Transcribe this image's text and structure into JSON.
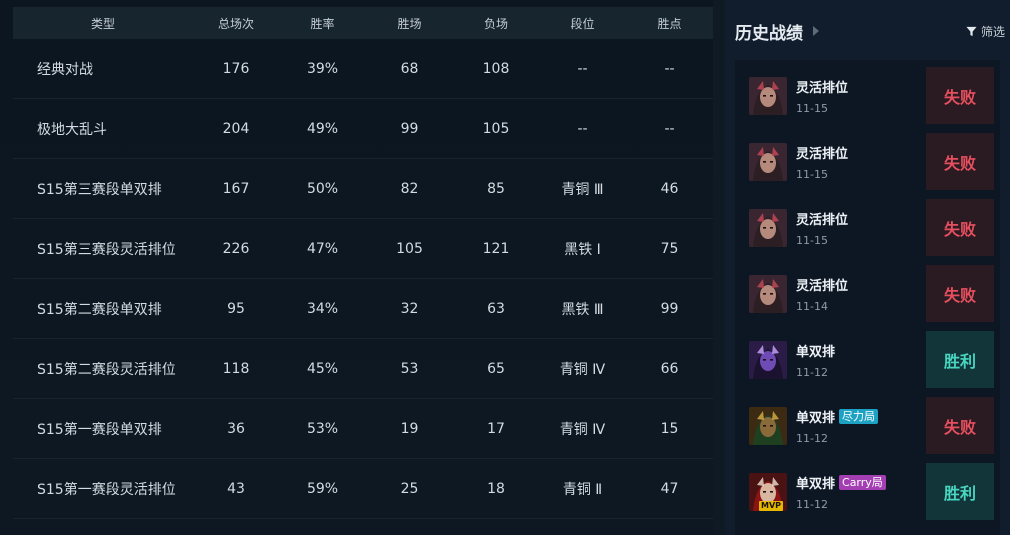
{
  "stats": {
    "headers": [
      "类型",
      "总场次",
      "胜率",
      "胜场",
      "负场",
      "段位",
      "胜点"
    ],
    "rows": [
      [
        "经典对战",
        "176",
        "39%",
        "68",
        "108",
        "--",
        "--"
      ],
      [
        "极地大乱斗",
        "204",
        "49%",
        "99",
        "105",
        "--",
        "--"
      ],
      [
        "S15第三赛段单双排",
        "167",
        "50%",
        "82",
        "85",
        "青铜 Ⅲ",
        "46"
      ],
      [
        "S15第三赛段灵活排位",
        "226",
        "47%",
        "105",
        "121",
        "黑铁 Ⅰ",
        "75"
      ],
      [
        "S15第二赛段单双排",
        "95",
        "34%",
        "32",
        "63",
        "黑铁 Ⅲ",
        "99"
      ],
      [
        "S15第二赛段灵活排位",
        "118",
        "45%",
        "53",
        "65",
        "青铜 Ⅳ",
        "66"
      ],
      [
        "S15第一赛段单双排",
        "36",
        "53%",
        "19",
        "17",
        "青铜 Ⅳ",
        "15"
      ],
      [
        "S15第一赛段灵活排位",
        "43",
        "59%",
        "25",
        "18",
        "青铜 Ⅱ",
        "47"
      ]
    ]
  },
  "history": {
    "title": "历史战绩",
    "filter_label": "筛选",
    "matches": [
      {
        "mode": "灵活排位",
        "date": "11-15",
        "result": "失败",
        "outcome": "loss",
        "champion_icon": "champion-avatar-icon",
        "tag": "",
        "mvp": ""
      },
      {
        "mode": "灵活排位",
        "date": "11-15",
        "result": "失败",
        "outcome": "loss",
        "champion_icon": "champion-avatar-icon",
        "tag": "",
        "mvp": ""
      },
      {
        "mode": "灵活排位",
        "date": "11-15",
        "result": "失败",
        "outcome": "loss",
        "champion_icon": "champion-avatar-icon",
        "tag": "",
        "mvp": ""
      },
      {
        "mode": "灵活排位",
        "date": "11-14",
        "result": "失败",
        "outcome": "loss",
        "champion_icon": "champion-avatar-icon",
        "tag": "",
        "mvp": ""
      },
      {
        "mode": "单双排",
        "date": "11-12",
        "result": "胜利",
        "outcome": "win",
        "champion_icon": "champion-avatar-icon",
        "tag": "",
        "mvp": ""
      },
      {
        "mode": "单双排",
        "date": "11-12",
        "result": "失败",
        "outcome": "loss",
        "champion_icon": "champion-avatar-icon",
        "tag": "尽力局",
        "mvp": ""
      },
      {
        "mode": "单双排",
        "date": "11-12",
        "result": "胜利",
        "outcome": "win",
        "champion_icon": "champion-avatar-icon",
        "tag": "Carry局",
        "mvp": "MVP"
      }
    ]
  },
  "colors": {
    "loss": "#e64f5e",
    "win": "#48d6c0",
    "tag_cyan": "#1da2c4",
    "tag_purple": "#a43fb3",
    "mvp": "#e5b800"
  }
}
